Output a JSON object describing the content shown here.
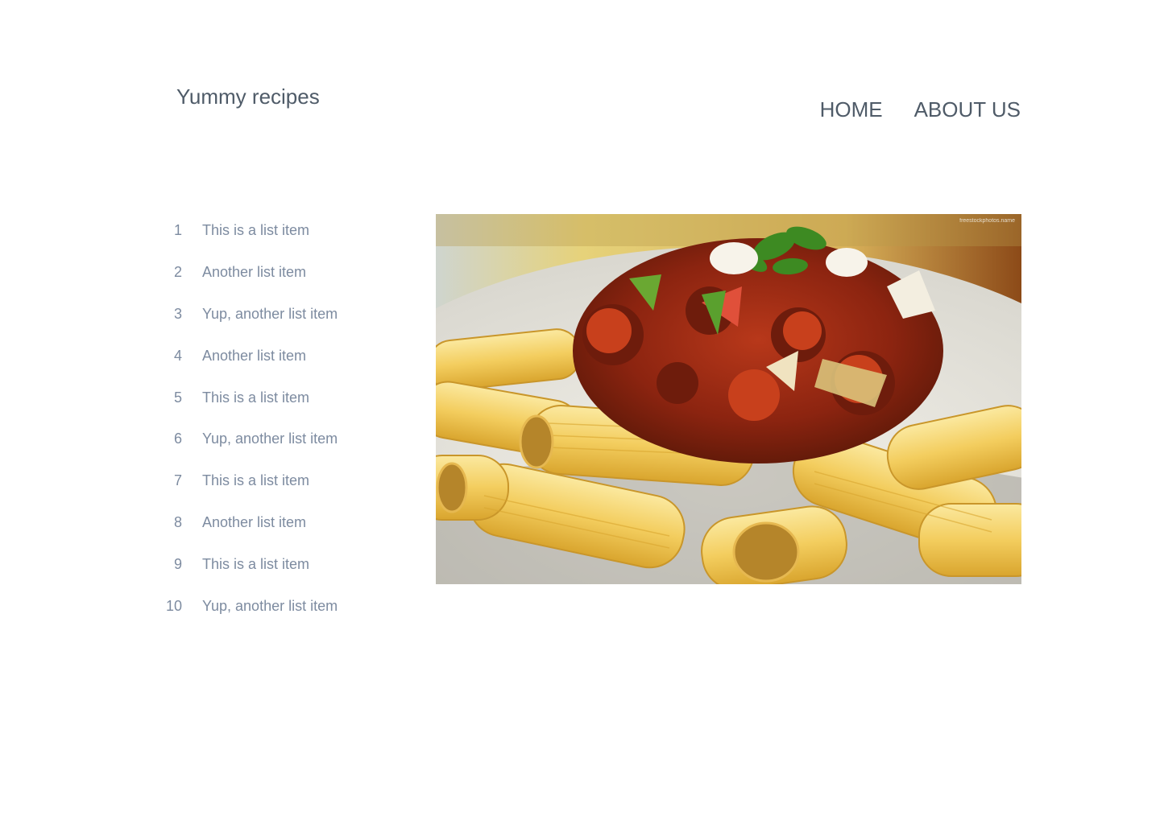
{
  "header": {
    "title": "Yummy recipes",
    "nav": [
      {
        "label": "HOME"
      },
      {
        "label": "ABOUT US"
      }
    ]
  },
  "list": [
    {
      "num": "1",
      "text": "This is a list item"
    },
    {
      "num": "2",
      "text": "Another list item"
    },
    {
      "num": "3",
      "text": "Yup, another list item"
    },
    {
      "num": "4",
      "text": "Another list item"
    },
    {
      "num": "5",
      "text": "This is a list item"
    },
    {
      "num": "6",
      "text": "Yup, another list item"
    },
    {
      "num": "7",
      "text": "This is a list item"
    },
    {
      "num": "8",
      "text": "Another list item"
    },
    {
      "num": "9",
      "text": "This is a list item"
    },
    {
      "num": "10",
      "text": "Yup, another list item"
    }
  ],
  "hero": {
    "watermark": "freestockphotos.name"
  },
  "colors": {
    "text": "#4f5b68",
    "list_text": "#7d8ba0",
    "background": "#ffffff"
  }
}
